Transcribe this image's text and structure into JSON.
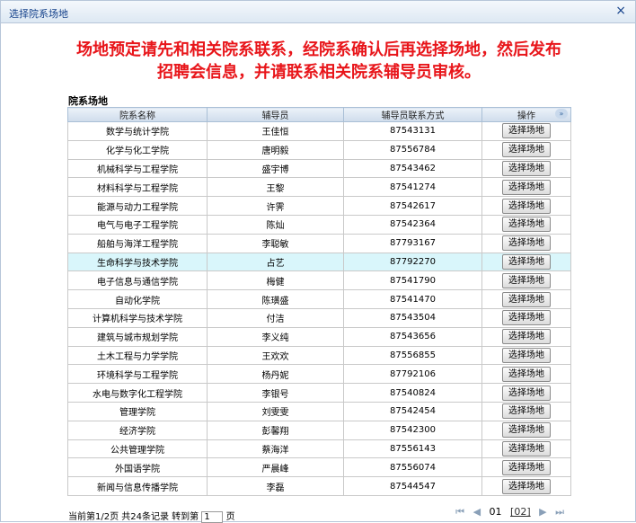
{
  "window": {
    "title": "选择院系场地",
    "close_glyph": "×"
  },
  "notice": {
    "line1": "场地预定请先和相关院系联系，经院系确认后再选择场地，然后发布",
    "line2": "招聘会信息，并请联系相关院系辅导员审核。"
  },
  "section_label": "院系场地",
  "table": {
    "headers": {
      "name": "院系名称",
      "counselor": "辅导员",
      "phone": "辅导员联系方式",
      "op": "操作"
    },
    "expand_glyph": "»",
    "button_label": "选择场地",
    "rows": [
      {
        "name": "数学与统计学院",
        "counselor": "王佳恒",
        "phone": "87543131"
      },
      {
        "name": "化学与化工学院",
        "counselor": "唐明毅",
        "phone": "87556784"
      },
      {
        "name": "机械科学与工程学院",
        "counselor": "盛宇博",
        "phone": "87543462"
      },
      {
        "name": "材料科学与工程学院",
        "counselor": "王黎",
        "phone": "87541274"
      },
      {
        "name": "能源与动力工程学院",
        "counselor": "许霁",
        "phone": "87542617"
      },
      {
        "name": "电气与电子工程学院",
        "counselor": "陈灿",
        "phone": "87542364"
      },
      {
        "name": "船舶与海洋工程学院",
        "counselor": "李聪敏",
        "phone": "87793167"
      },
      {
        "name": "生命科学与技术学院",
        "counselor": "占艺",
        "phone": "87792270"
      },
      {
        "name": "电子信息与通信学院",
        "counselor": "梅健",
        "phone": "87541790"
      },
      {
        "name": "自动化学院",
        "counselor": "陈璜盛",
        "phone": "87541470"
      },
      {
        "name": "计算机科学与技术学院",
        "counselor": "付洁",
        "phone": "87543504"
      },
      {
        "name": "建筑与城市规划学院",
        "counselor": "李义纯",
        "phone": "87543656"
      },
      {
        "name": "土木工程与力学学院",
        "counselor": "王欢欢",
        "phone": "87556855"
      },
      {
        "name": "环境科学与工程学院",
        "counselor": "杨丹妮",
        "phone": "87792106"
      },
      {
        "name": "水电与数字化工程学院",
        "counselor": "李银号",
        "phone": "87540824"
      },
      {
        "name": "管理学院",
        "counselor": "刘雯雯",
        "phone": "87542454"
      },
      {
        "name": "经济学院",
        "counselor": "彭馨翔",
        "phone": "87542300"
      },
      {
        "name": "公共管理学院",
        "counselor": "蔡海洋",
        "phone": "87556143"
      },
      {
        "name": "外国语学院",
        "counselor": "严晨峰",
        "phone": "87556074"
      },
      {
        "name": "新闻与信息传播学院",
        "counselor": "李磊",
        "phone": "87544547"
      }
    ],
    "highlighted_row_index": 7
  },
  "pager": {
    "status_prefix": "当前第1/2页 共24条记录 转到第",
    "page_input_value": "1",
    "status_suffix": "页",
    "first_glyph": "⏮",
    "prev_glyph": "◀",
    "current_page": "01",
    "next_page": "[02]",
    "next_glyph": "▶",
    "last_glyph": "⏭"
  }
}
